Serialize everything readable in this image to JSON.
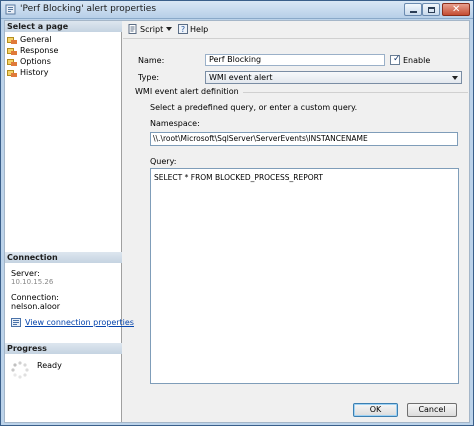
{
  "window": {
    "title": "'Perf Blocking' alert properties"
  },
  "left": {
    "select_page_header": "Select a page",
    "pages": [
      "General",
      "Response",
      "Options",
      "History"
    ],
    "connection_header": "Connection",
    "server_label": "Server:",
    "server_value": "10.10.15.26",
    "connection_label": "Connection:",
    "connection_value": "nelson.aloor",
    "view_connection_link": "View connection properties",
    "progress_header": "Progress",
    "progress_status": "Ready"
  },
  "toolbar": {
    "script_label": "Script",
    "help_label": "Help"
  },
  "form": {
    "name_label": "Name:",
    "name_value": "Perf Blocking",
    "enable_label": "Enable",
    "enable_checked": true,
    "type_label": "Type:",
    "type_value": "WMI event alert",
    "wmi_group_title": "WMI event alert definition",
    "instructions": "Select a predefined query, or enter a custom query.",
    "namespace_label": "Namespace:",
    "namespace_value": "\\\\.\\root\\Microsoft\\SqlServer\\ServerEvents\\INSTANCENAME",
    "query_label": "Query:",
    "query_value": "SELECT * FROM BLOCKED_PROCESS_REPORT"
  },
  "buttons": {
    "ok_label": "OK",
    "cancel_label": "Cancel"
  }
}
